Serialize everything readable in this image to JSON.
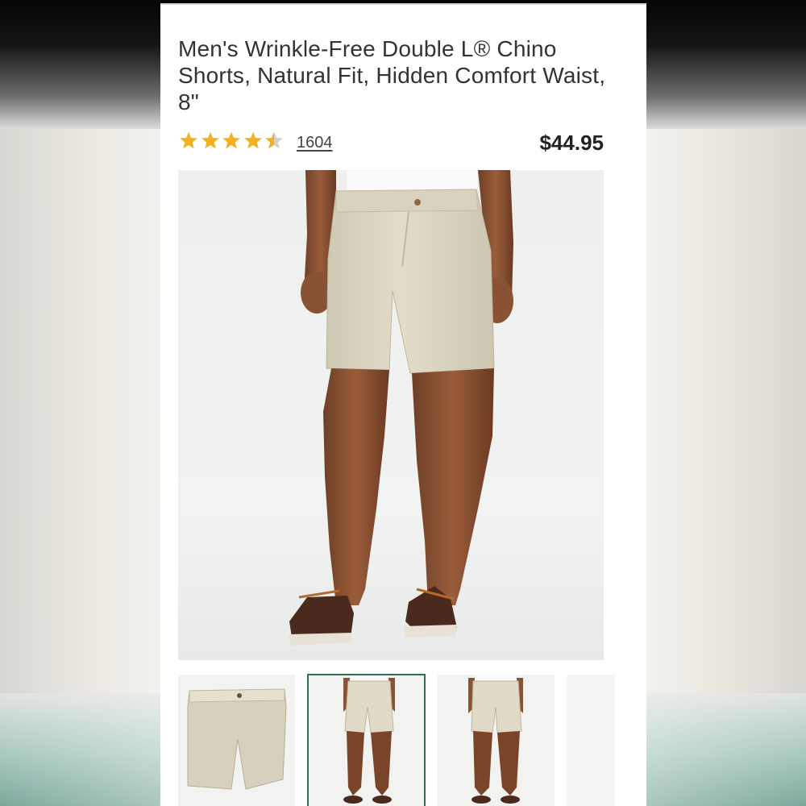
{
  "product": {
    "title": "Men's Wrinkle-Free Double L® Chino Shorts, Natural Fit, Hidden Comfort Waist, 8\"",
    "rating": 4.5,
    "rating_max": 5,
    "review_count": "1604",
    "price": "$44.95"
  },
  "colors": {
    "star": "#f4b223",
    "star_empty": "#d0d0d0",
    "khaki": "#ddd7c4",
    "selected_outline": "#2f6f4e"
  },
  "thumbnails": [
    {
      "name": "flat-lay",
      "selected": false
    },
    {
      "name": "model-front",
      "selected": true
    },
    {
      "name": "model-back",
      "selected": false
    },
    {
      "name": "partial",
      "selected": false
    }
  ]
}
